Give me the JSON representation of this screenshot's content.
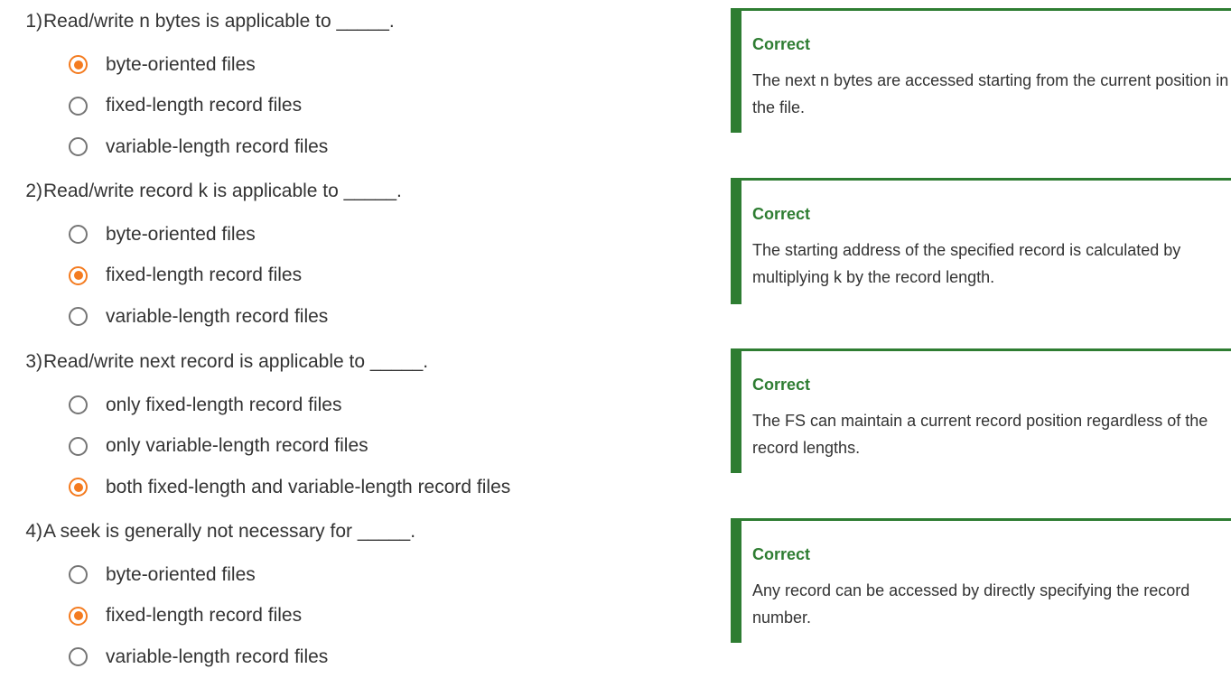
{
  "questions": [
    {
      "number": "1)",
      "text": "Read/write n bytes is applicable to _____.",
      "options": [
        {
          "label": "byte-oriented files",
          "selected": true
        },
        {
          "label": "fixed-length record files",
          "selected": false
        },
        {
          "label": "variable-length record files",
          "selected": false
        }
      ],
      "feedback": {
        "status": "Correct",
        "explanation": "The next n bytes are accessed starting from the current position in the file."
      }
    },
    {
      "number": "2)",
      "text": "Read/write record k is applicable to _____.",
      "options": [
        {
          "label": "byte-oriented files",
          "selected": false
        },
        {
          "label": "fixed-length record files",
          "selected": true
        },
        {
          "label": "variable-length record files",
          "selected": false
        }
      ],
      "feedback": {
        "status": "Correct",
        "explanation": "The starting address of the specified record is calculated by multiplying k by the record length."
      }
    },
    {
      "number": "3)",
      "text": "Read/write next record is applicable to _____.",
      "options": [
        {
          "label": "only fixed-length record files",
          "selected": false
        },
        {
          "label": "only variable-length record files",
          "selected": false
        },
        {
          "label": "both fixed-length and variable-length record files",
          "selected": true
        }
      ],
      "feedback": {
        "status": "Correct",
        "explanation": "The FS can maintain a current record position regardless of the record lengths."
      }
    },
    {
      "number": "4)",
      "text": "A seek is generally not necessary for _____.",
      "options": [
        {
          "label": "byte-oriented files",
          "selected": false
        },
        {
          "label": "fixed-length record files",
          "selected": true
        },
        {
          "label": "variable-length record files",
          "selected": false
        }
      ],
      "feedback": {
        "status": "Correct",
        "explanation": "Any record can be accessed by directly specifying the record number."
      }
    }
  ],
  "colors": {
    "accent": "#f47b1f",
    "correct": "#2e7d32",
    "text": "#333333"
  }
}
